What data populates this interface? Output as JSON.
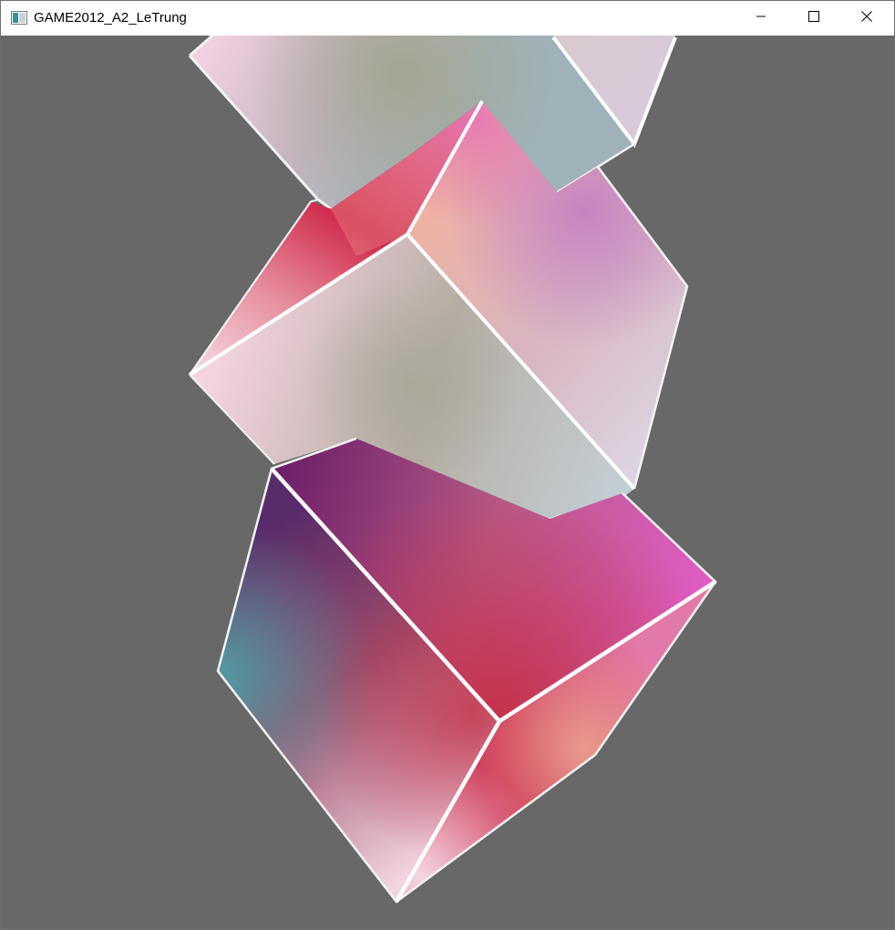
{
  "window": {
    "title": "GAME2012_A2_LeTrung",
    "icon": "app-window-icon",
    "controls": {
      "minimize_icon": "minimize-icon",
      "maximize_icon": "maximize-icon",
      "close_icon": "close-icon"
    }
  },
  "scene": {
    "background_color": "#686868",
    "edge_color": "#ffffff",
    "cubes": [
      {
        "name": "top-cube",
        "colors": [
          "#f3d3e3",
          "#a3a591",
          "#c2cdd8",
          "#d8cadf"
        ]
      },
      {
        "name": "middle-cube",
        "colors": [
          "#d12e4f",
          "#e574b4",
          "#eeb2a2",
          "#a6a595",
          "#c3cfd6"
        ]
      },
      {
        "name": "bottom-cube",
        "colors": [
          "#6b1d68",
          "#e05cc4",
          "#c63148",
          "#4f9fa4",
          "#f6d6e3"
        ]
      }
    ]
  }
}
